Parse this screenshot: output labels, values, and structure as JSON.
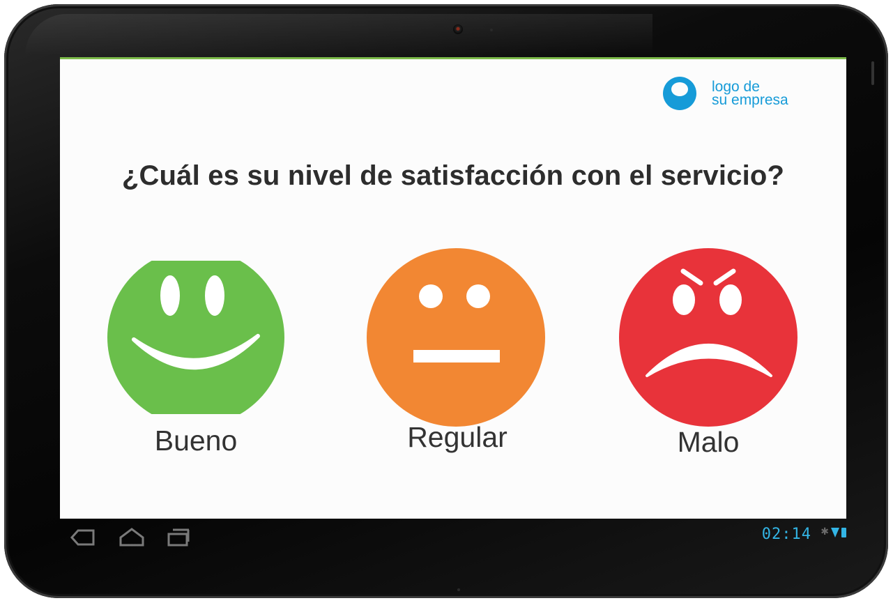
{
  "logo": {
    "line1": "logo de",
    "line2": "su empresa",
    "color": "#169bd8"
  },
  "question": "¿Cuál es su nivel de satisfacción con el servicio?",
  "faces": [
    {
      "id": "good",
      "label": "Bueno",
      "color": "#6abf4b",
      "icon": "smile-face-icon"
    },
    {
      "id": "regular",
      "label": "Regular",
      "color": "#f28733",
      "icon": "neutral-face-icon"
    },
    {
      "id": "bad",
      "label": "Malo",
      "color": "#e8333a",
      "icon": "angry-face-icon"
    }
  ],
  "statusbar": {
    "time": "02:14",
    "accent": "#33b5e5"
  },
  "navbar": {
    "icons": [
      "back-icon",
      "home-icon",
      "recent-apps-icon"
    ]
  }
}
